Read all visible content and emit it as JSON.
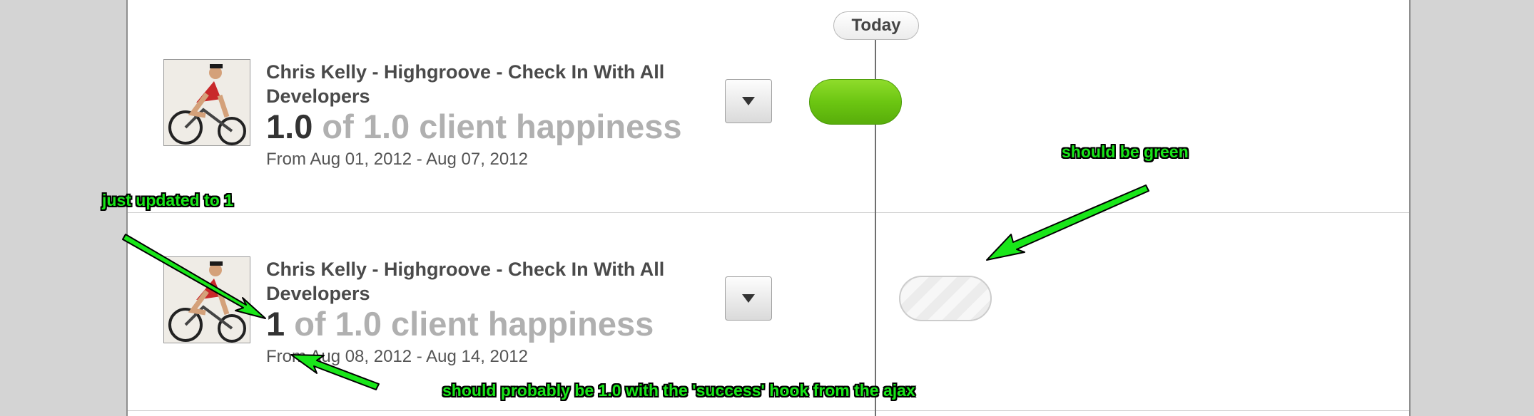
{
  "timeline": {
    "today_label": "Today"
  },
  "goals": [
    {
      "title": "Chris Kelly - Highgroove - Check In With All Developers",
      "score_value": "1.0",
      "score_rest": " of 1.0 client happiness",
      "date_range": "From Aug 01, 2012 - Aug 07, 2012",
      "status": "success",
      "status_color": "#6cc612"
    },
    {
      "title": "Chris Kelly - Highgroove - Check In With All Developers",
      "score_value": "1",
      "score_rest": " of 1.0 client happiness",
      "date_range": "From Aug 08, 2012 - Aug 14, 2012",
      "status": "empty",
      "status_color": "#ececec"
    }
  ],
  "annotations": {
    "just_updated": "just updated to 1",
    "should_be_green": "should be green",
    "should_probably": "should probably be 1.0 with the 'success' hook from the ajax",
    "color": "#19e619"
  },
  "icons": {
    "dropdown": "triangle-down-icon",
    "avatar": "cyclist-photo"
  }
}
